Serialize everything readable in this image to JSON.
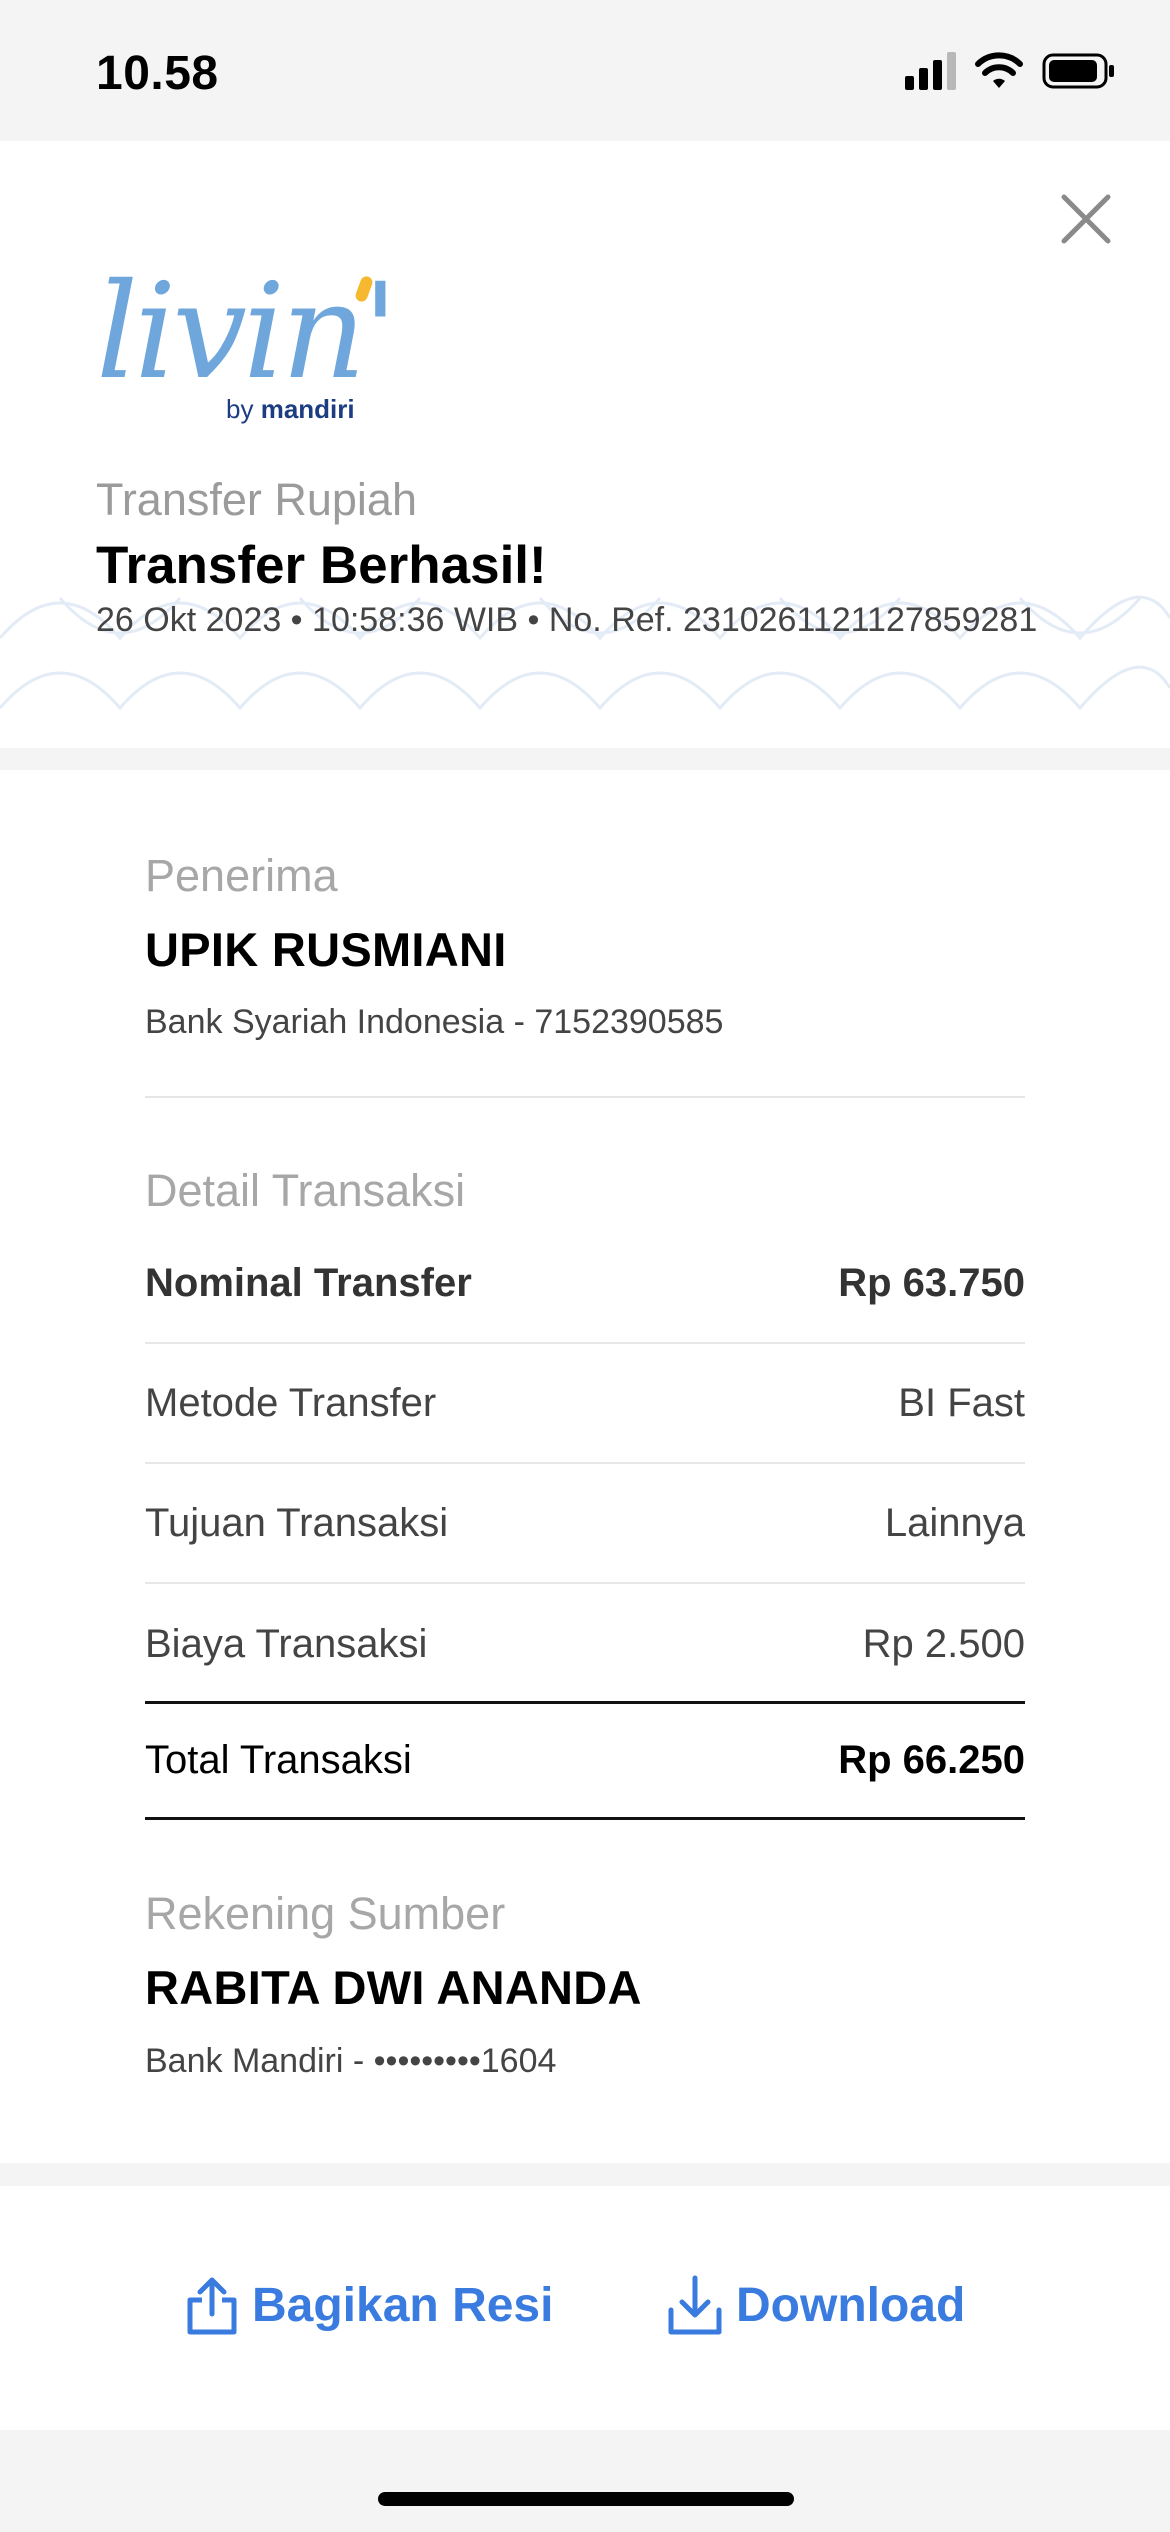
{
  "status_bar": {
    "time": "10.58"
  },
  "header": {
    "logo_text": "livin'",
    "logo_by": "by",
    "logo_brand": "mandiri",
    "transaction_type": "Transfer Rupiah",
    "status_title": "Transfer Berhasil!",
    "meta": "26 Okt 2023 • 10:58:36 WIB • No. Ref. 2310261121127859281"
  },
  "recipient": {
    "label": "Penerima",
    "name": "UPIK RUSMIANI",
    "bank_account": "Bank Syariah Indonesia - 7152390585"
  },
  "details": {
    "label": "Detail Transaksi",
    "rows": [
      {
        "label": "Nominal Transfer",
        "value": "Rp 63.750"
      },
      {
        "label": "Metode Transfer",
        "value": "BI Fast"
      },
      {
        "label": "Tujuan Transaksi",
        "value": "Lainnya"
      },
      {
        "label": "Biaya Transaksi",
        "value": "Rp 2.500"
      }
    ],
    "total_label": "Total Transaksi",
    "total_value": "Rp 66.250"
  },
  "source": {
    "label": "Rekening Sumber",
    "name": "RABITA DWI ANANDA",
    "bank_account": "Bank Mandiri - •••••••••1604"
  },
  "actions": {
    "share_label": "Bagikan Resi",
    "download_label": "Download"
  },
  "colors": {
    "accent": "#3a7be0",
    "logo_blue": "#6fa7dc",
    "logo_yellow": "#f5b82e",
    "brand_navy": "#1c3d82"
  }
}
